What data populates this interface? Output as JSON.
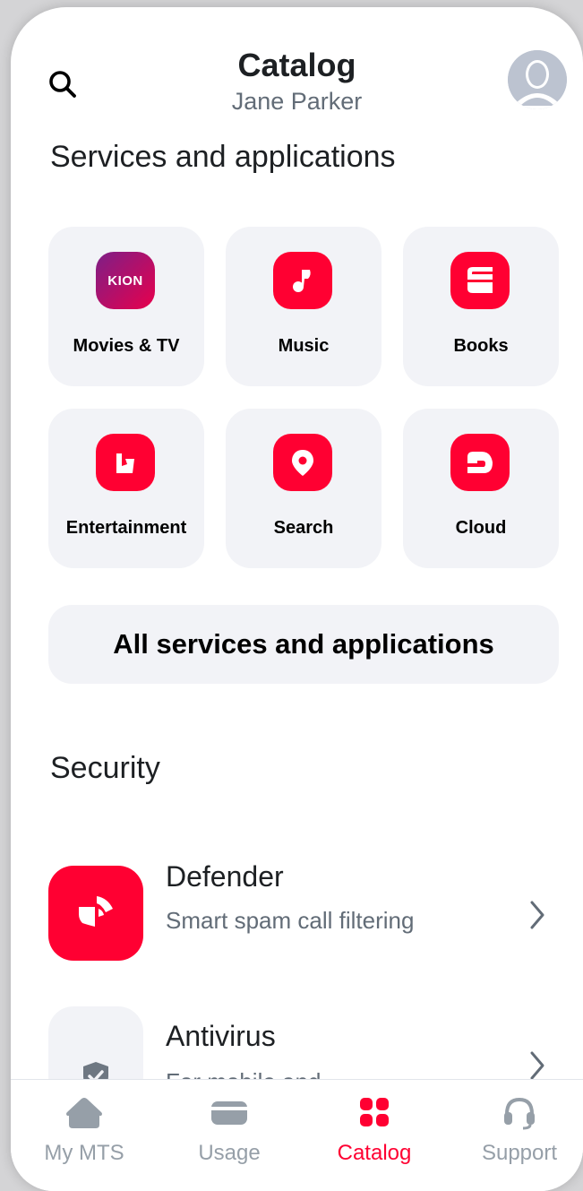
{
  "header": {
    "title": "Catalog",
    "subtitle": "Jane Parker",
    "search_icon": "search-icon",
    "avatar_icon": "user-avatar-icon"
  },
  "services": {
    "title": "Services and applications",
    "tiles": [
      {
        "label": "Movies & TV",
        "icon": "kion-icon",
        "logo_text": "KION"
      },
      {
        "label": "Music",
        "icon": "music-note-icon"
      },
      {
        "label": "Books",
        "icon": "book-icon"
      },
      {
        "label": "Entertainment",
        "icon": "entertainment-icon"
      },
      {
        "label": "Search",
        "icon": "location-pin-icon"
      },
      {
        "label": "Cloud",
        "icon": "cloud-icon"
      }
    ],
    "all_button": "All services and applications"
  },
  "security": {
    "title": "Security",
    "items": [
      {
        "title": "Defender",
        "description": "Smart spam call filtering",
        "icon": "shield-defender-icon"
      },
      {
        "title": "Antivirus",
        "description": "For mobile and ...",
        "icon": "shield-check-icon"
      }
    ]
  },
  "tabbar": {
    "tabs": [
      {
        "label": "My MTS",
        "icon": "home-icon",
        "active": false
      },
      {
        "label": "Usage",
        "icon": "wallet-icon",
        "active": false
      },
      {
        "label": "Catalog",
        "icon": "grid-icon",
        "active": true
      },
      {
        "label": "Support",
        "icon": "headset-icon",
        "active": false
      }
    ]
  },
  "colors": {
    "accent": "#ff0032",
    "kion_gradient_start": "#7d1f87",
    "kion_gradient_end": "#e8004c",
    "tile_bg": "#f2f3f7",
    "inactive_text": "#969fa8",
    "secondary_text": "#626c77"
  }
}
